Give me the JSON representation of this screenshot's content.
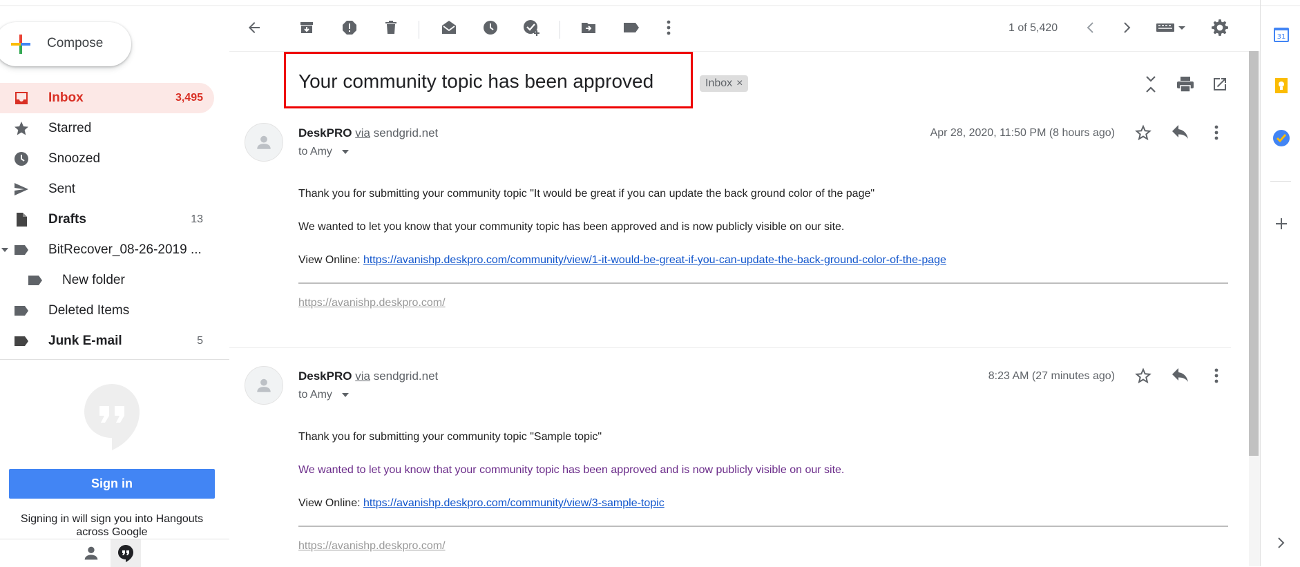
{
  "compose": {
    "label": "Compose"
  },
  "nav": [
    {
      "name": "Inbox",
      "count": "3,495"
    },
    {
      "name": "Starred",
      "count": ""
    },
    {
      "name": "Snoozed",
      "count": ""
    },
    {
      "name": "Sent",
      "count": ""
    },
    {
      "name": "Drafts",
      "count": "13"
    },
    {
      "name": "BitRecover_08-26-2019 ...",
      "count": ""
    },
    {
      "name": "New folder",
      "count": ""
    },
    {
      "name": "Deleted Items",
      "count": ""
    },
    {
      "name": "Junk E-mail",
      "count": "5"
    }
  ],
  "hangouts": {
    "signin_label": "Sign in",
    "note": "Signing in will sign you into Hangouts across Google"
  },
  "toolbar": {
    "pager": "1 of 5,420"
  },
  "thread": {
    "subject": "Your community topic has been approved",
    "label": "Inbox",
    "label_remove": "×"
  },
  "messages": [
    {
      "sender": "DeskPRO",
      "via": "via",
      "domain": "sendgrid.net",
      "to": "to Amy",
      "date": "Apr 28, 2020, 11:50 PM (8 hours ago)",
      "line1": "Thank you for submitting your community topic \"It would be great if you can update the back ground color of the page\"",
      "line2": "We wanted to let you know that your community topic has been approved and is now publicly visible on our site.",
      "view_label": "View Online:",
      "view_link": "https://avanishp.deskpro.com/community/view/1-it-would-be-great-if-you-can-update-the-back-ground-color-of-the-page",
      "footer_link": "https://avanishp.deskpro.com/"
    },
    {
      "sender": "DeskPRO",
      "via": "via",
      "domain": "sendgrid.net",
      "to": "to Amy",
      "date": "8:23 AM (27 minutes ago)",
      "line1": "Thank you for submitting your community topic \"Sample topic\"",
      "line2": "We wanted to let you know that your community topic has been approved and is now publicly visible on our site.",
      "view_label": "View Online:",
      "view_link": "https://avanishp.deskpro.com/community/view/3-sample-topic",
      "footer_link": "https://avanishp.deskpro.com/"
    }
  ],
  "right_panel": {
    "calendar_day": "31"
  },
  "colors": {
    "accent_red": "#d93025",
    "link": "#1155cc",
    "signin_blue": "#4285f4",
    "highlight_box": "#ee0000"
  }
}
